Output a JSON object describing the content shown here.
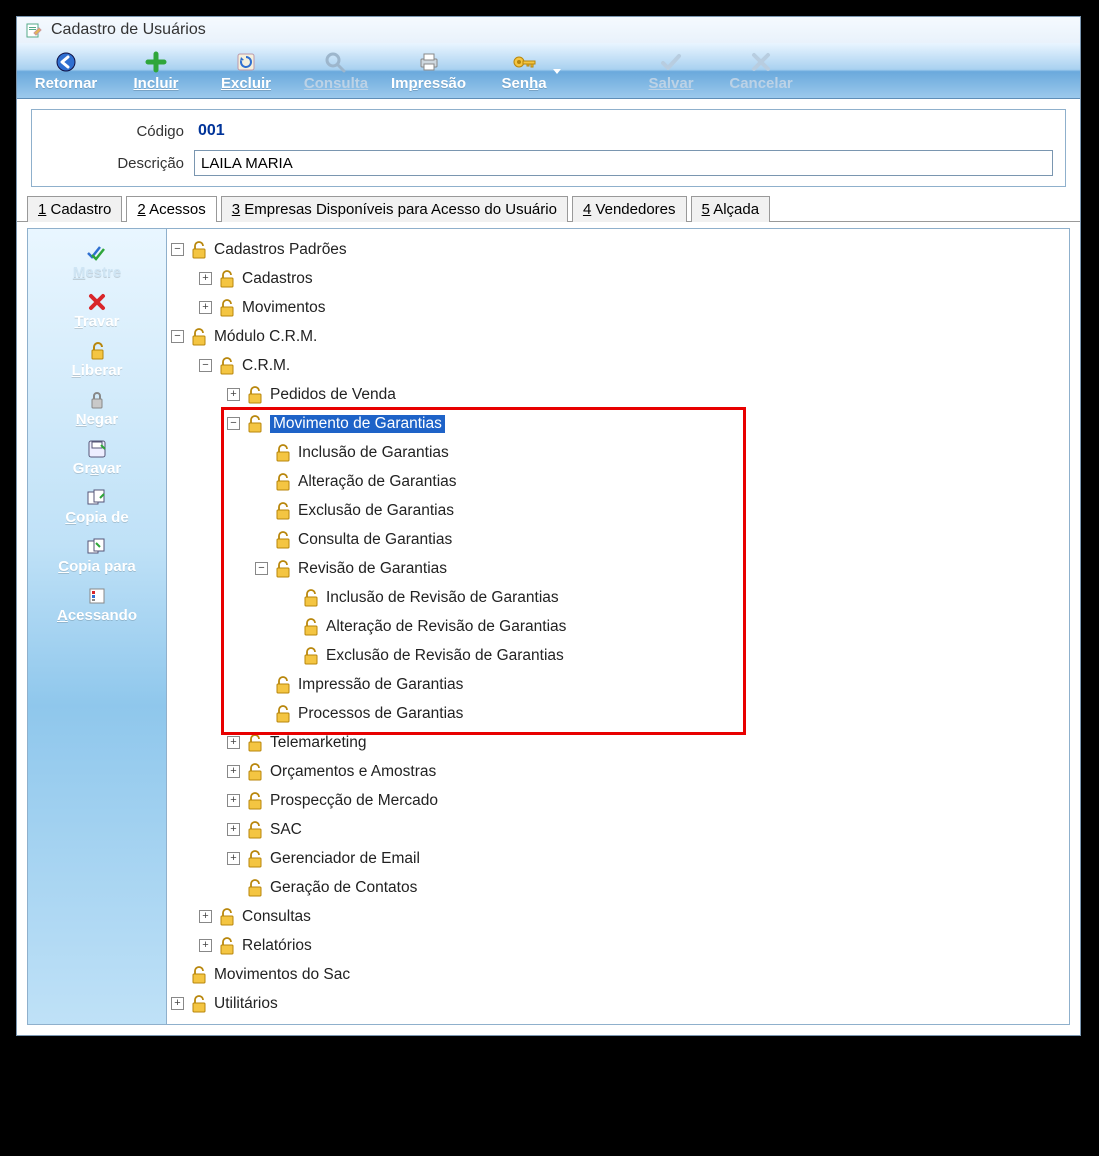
{
  "window": {
    "title": "Cadastro de Usuários"
  },
  "toolbar": {
    "retornar": "Retornar",
    "incluir": "Incluir",
    "excluir": "Excluir",
    "consulta": "Consulta",
    "impressao": "Impressão",
    "senha": "Senha",
    "salvar": "Salvar",
    "cancelar": "Cancelar"
  },
  "form": {
    "codigo_label": "Código",
    "codigo_value": "001",
    "descricao_label": "Descrição",
    "descricao_value": "LAILA MARIA"
  },
  "tabs": {
    "t1": "1 Cadastro",
    "t2": "2 Acessos",
    "t3": "3 Empresas Disponíveis para Acesso do Usuário",
    "t4": "4 Vendedores",
    "t5": "5 Alçada"
  },
  "side": {
    "mestre": "Mestre",
    "travar": "Travar",
    "liberar": "Liberar",
    "negar": "Negar",
    "gravar": "Gravar",
    "copia_de": "Copia de",
    "copia_para": "Copia para",
    "acessando": "Acessando"
  },
  "tree": {
    "cadastros_padroes": "Cadastros Padrões",
    "cadastros": "Cadastros",
    "movimentos": "Movimentos",
    "modulo_crm": "Módulo C.R.M.",
    "crm": "C.R.M.",
    "pedidos_venda": "Pedidos de Venda",
    "mov_garantias": "Movimento de Garantias",
    "inc_garantias": "Inclusão de Garantias",
    "alt_garantias": "Alteração de Garantias",
    "exc_garantias": "Exclusão de Garantias",
    "con_garantias": "Consulta de Garantias",
    "rev_garantias": "Revisão de Garantias",
    "inc_rev_garantias": "Inclusão de Revisão de Garantias",
    "alt_rev_garantias": "Alteração de Revisão de Garantias",
    "exc_rev_garantias": "Exclusão de Revisão de Garantias",
    "imp_garantias": "Impressão de Garantias",
    "proc_garantias": "Processos de Garantias",
    "telemarketing": "Telemarketing",
    "orcamentos": "Orçamentos e Amostras",
    "prospeccao": "Prospecção de Mercado",
    "sac": "SAC",
    "ger_email": "Gerenciador de Email",
    "ger_contatos": "Geração de Contatos",
    "consultas": "Consultas",
    "relatorios": "Relatórios",
    "mov_sac": "Movimentos do Sac",
    "utilitarios": "Utilitários"
  }
}
